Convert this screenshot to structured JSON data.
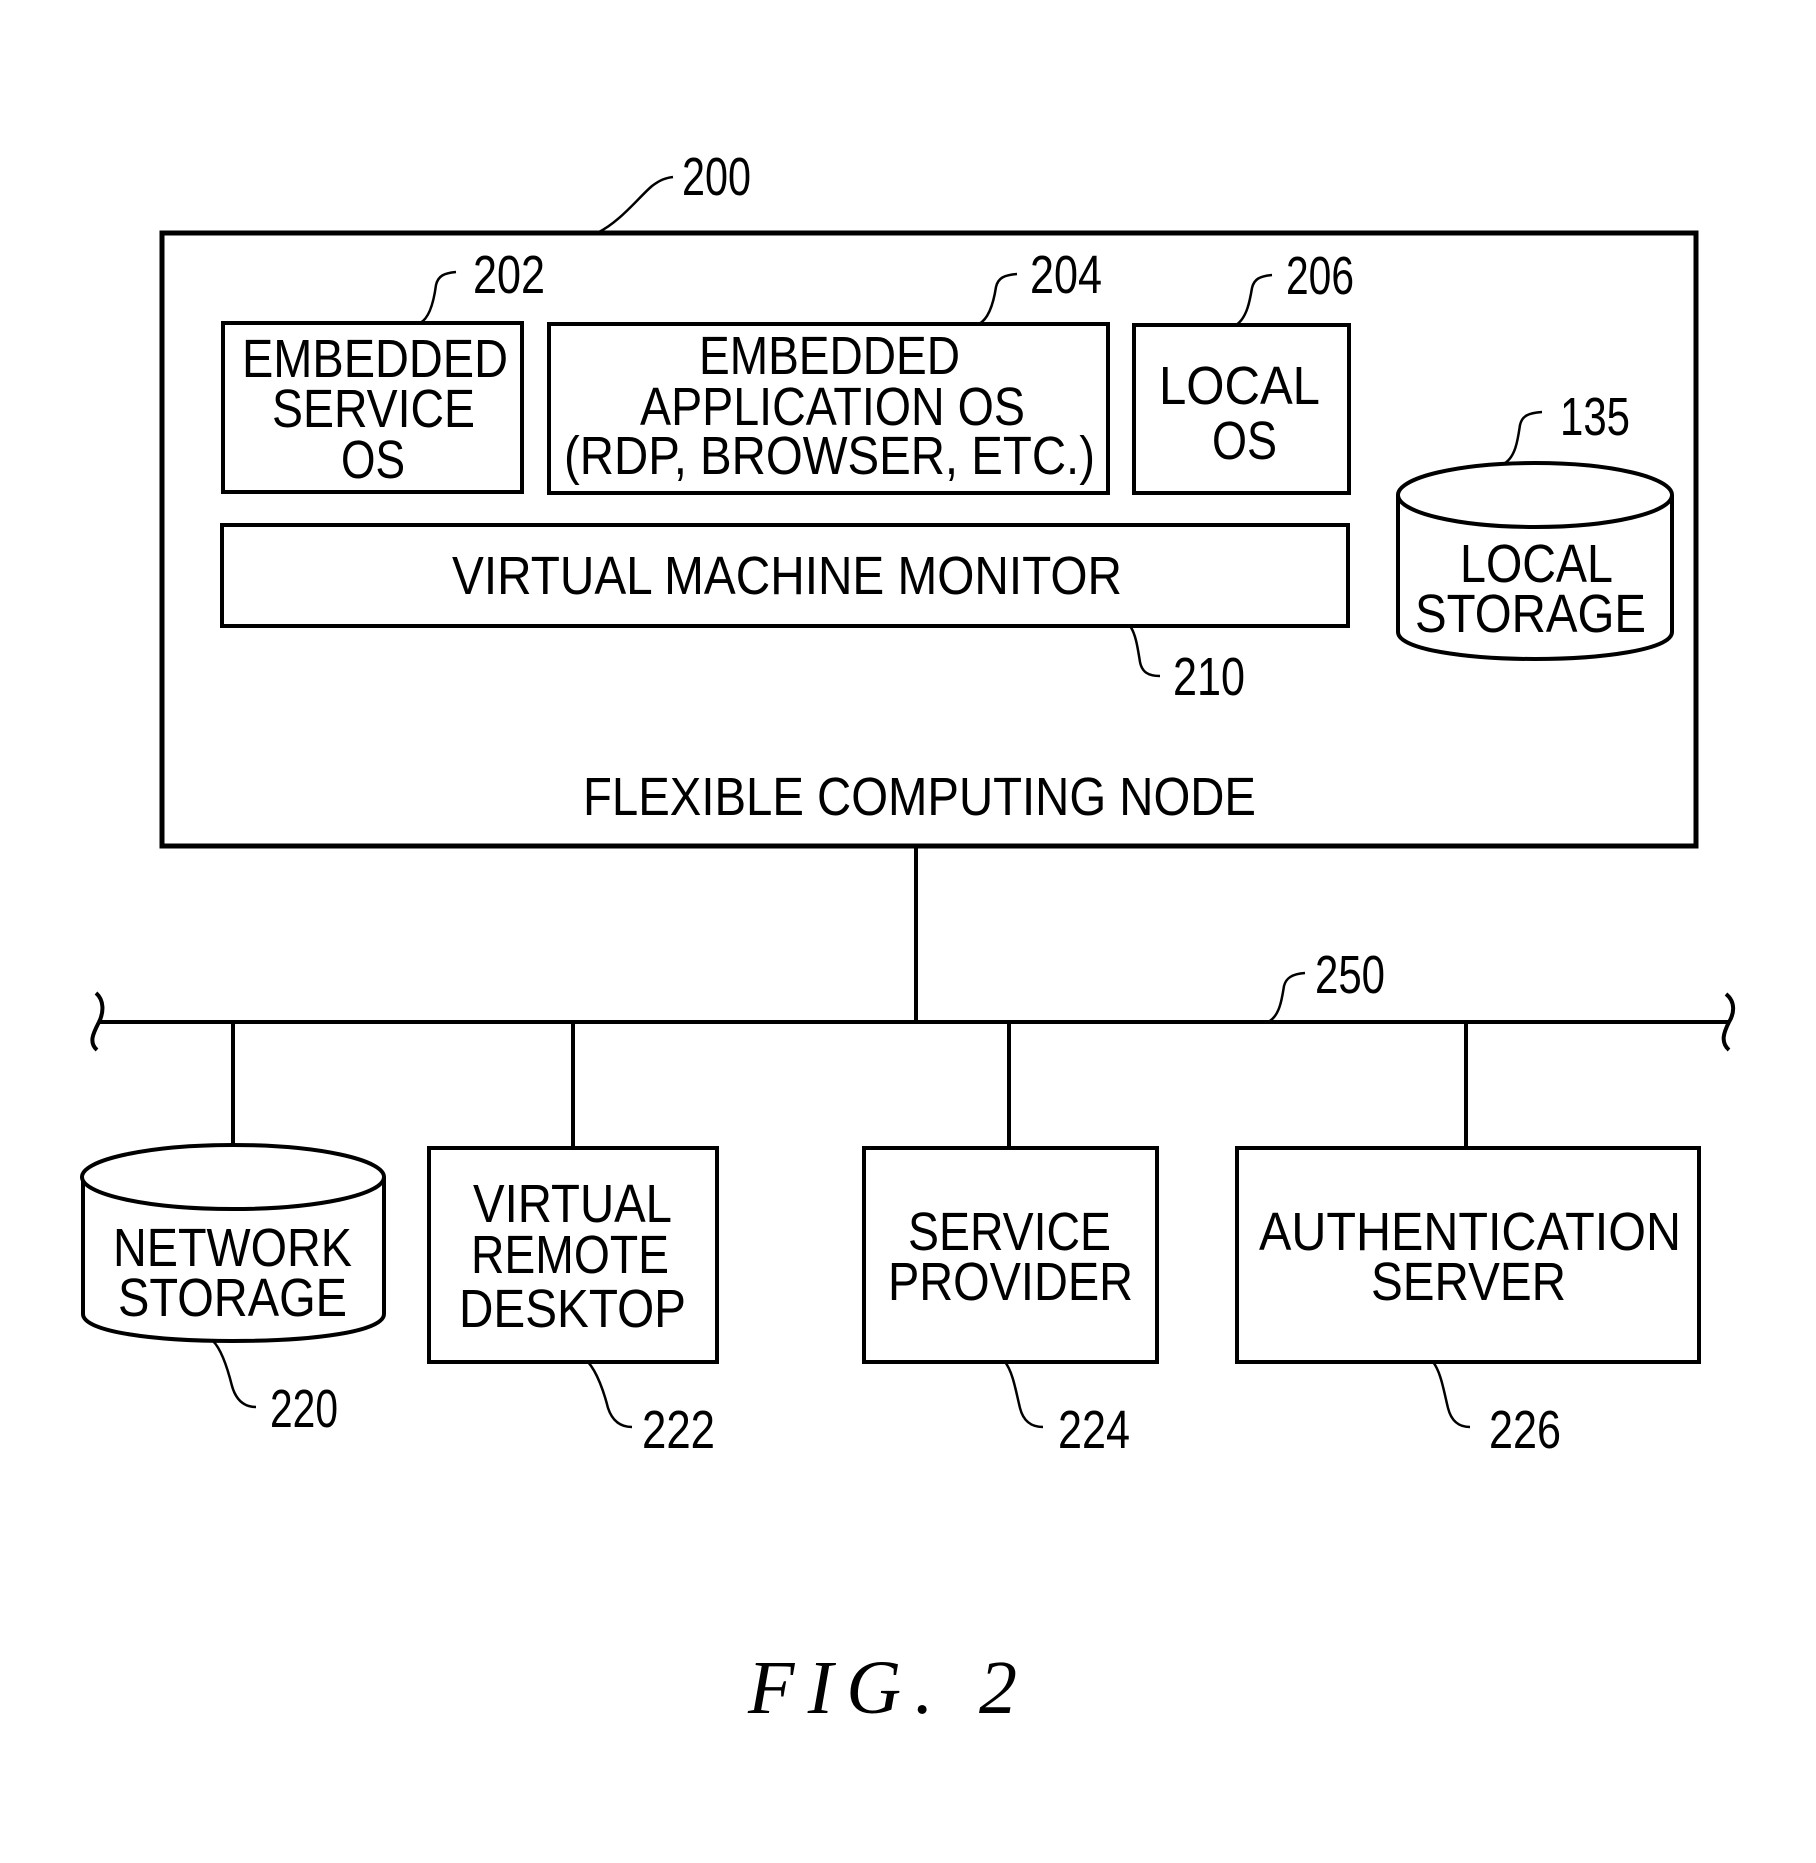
{
  "figure": {
    "caption": "FIG. 2",
    "node": {
      "ref": "200",
      "title": "FLEXIBLE COMPUTING NODE",
      "components": [
        {
          "ref": "202",
          "lines": [
            "EMBEDDED",
            "SERVICE",
            "OS"
          ]
        },
        {
          "ref": "204",
          "lines": [
            "EMBEDDED",
            "APPLICATION OS",
            "(RDP, BROWSER, ETC.)"
          ]
        },
        {
          "ref": "206",
          "lines": [
            "LOCAL",
            "OS"
          ]
        },
        {
          "ref": "210",
          "lines": [
            "VIRTUAL MACHINE MONITOR"
          ]
        },
        {
          "ref": "135",
          "lines": [
            "LOCAL",
            "STORAGE"
          ],
          "shape": "cylinder"
        }
      ]
    },
    "network": {
      "ref": "250"
    },
    "peers": [
      {
        "ref": "220",
        "lines": [
          "NETWORK",
          "STORAGE"
        ],
        "shape": "cylinder"
      },
      {
        "ref": "222",
        "lines": [
          "VIRTUAL",
          "REMOTE",
          "DESKTOP"
        ]
      },
      {
        "ref": "224",
        "lines": [
          "SERVICE",
          "PROVIDER"
        ]
      },
      {
        "ref": "226",
        "lines": [
          "AUTHENTICATION",
          "SERVER"
        ]
      }
    ]
  }
}
